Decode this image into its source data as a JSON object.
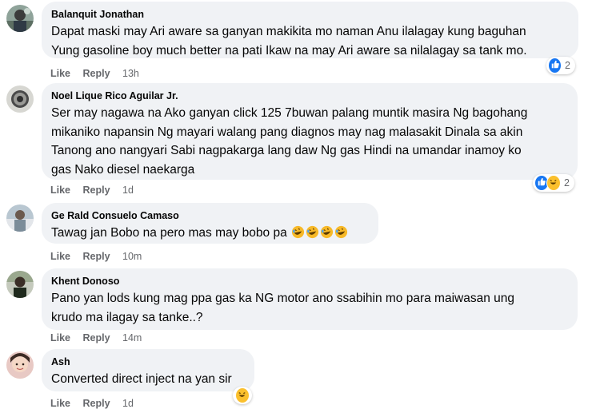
{
  "colors": {
    "bubble_bg": "#f0f2f5",
    "text": "#050505",
    "secondary_text": "#65676b",
    "like_blue": "#1877f2",
    "haha_yellow": "#fbc02d"
  },
  "comments": [
    {
      "author": "Balanquit Jonathan",
      "lines": [
        "Dapat maski may Ari aware sa ganyan makikita mo naman Anu ilalagay kung baguhan",
        "Yung gasoline boy much better na pati Ikaw na may Ari aware sa nilalagay sa tank mo."
      ],
      "like_label": "Like",
      "reply_label": "Reply",
      "time": "13h",
      "reaction_icons": [
        "like-icon"
      ],
      "reaction_count": "2"
    },
    {
      "author": "Noel Lique Rico Aguilar Jr.",
      "lines": [
        "Ser may nagawa na Ako ganyan click 125 7buwan palang muntik masira Ng bagohang",
        "mikaniko napansin Ng mayari walang pang diagnos may nag malasakit Dinala sa akin",
        "Tanong ano nangyari Sabi nagpakarga lang daw Ng gas Hindi na umandar inamoy ko",
        "gas Nako diesel naekarga"
      ],
      "like_label": "Like",
      "reply_label": "Reply",
      "time": "1d",
      "reaction_icons": [
        "like-icon",
        "haha-icon"
      ],
      "reaction_count": "2"
    },
    {
      "author": "Ge Rald Consuelo Camaso",
      "lines": [
        "Tawag jan Bobo na pero mas may bobo pa"
      ],
      "trailing_emojis": [
        "rofl-emoji",
        "rofl-emoji",
        "rofl-emoji",
        "rofl-emoji"
      ],
      "like_label": "Like",
      "reply_label": "Reply",
      "time": "10m"
    },
    {
      "author": "Khent Donoso",
      "lines": [
        "Pano yan lods kung mag ppa gas ka NG motor ano ssabihin mo para maiwasan ung",
        "krudo ma ilagay sa tanke..?"
      ],
      "like_label": "Like",
      "reply_label": "Reply",
      "time": "14m"
    },
    {
      "author": "Ash",
      "lines": [
        "Converted direct inject na yan sir"
      ],
      "like_label": "Like",
      "reply_label": "Reply",
      "time": "1d",
      "reaction_icons": [
        "haha-icon"
      ]
    }
  ]
}
